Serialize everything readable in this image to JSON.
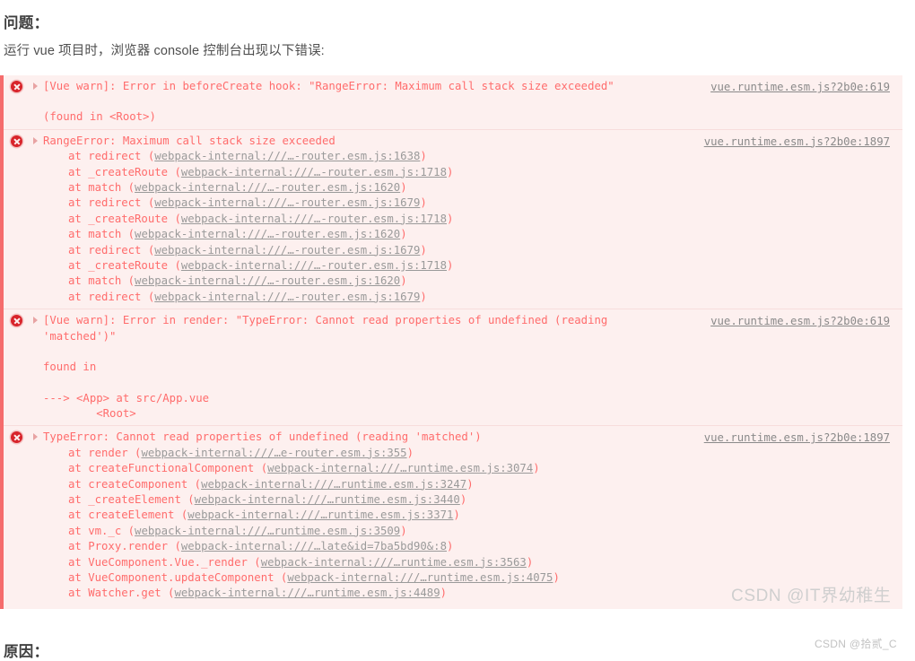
{
  "headings": {
    "problem": "问题：",
    "cause": "原因："
  },
  "intro": "运行 vue 项目时，浏览器 console 控制台出现以下错误:",
  "colors": {
    "console_background": "#fdf0ef",
    "console_border": "#f56c6c",
    "error_text": "#ff6c6c",
    "error_icon": "#d8232a",
    "link": "#8a8a8a",
    "heading": "#3f3f3f",
    "watermark": "#cfcfcf"
  },
  "console": {
    "rows": [
      {
        "id": "vue-warn-beforecreate",
        "icon": "error-circle-icon",
        "caret": "disclosure-triangle-icon",
        "message": "[Vue warn]: Error in beforeCreate hook: \"RangeError: Maximum call stack size exceeded\"",
        "source": "vue.runtime.esm.js?2b0e:619",
        "detail": "(found in <Root>)"
      },
      {
        "id": "rangeerror-stack",
        "icon": "error-circle-icon",
        "caret": "disclosure-triangle-icon",
        "message": "RangeError: Maximum call stack size exceeded",
        "source": "vue.runtime.esm.js?2b0e:1897",
        "stack": [
          {
            "fn": "at redirect",
            "loc": "webpack-internal:///…-router.esm.js:1638"
          },
          {
            "fn": "at _createRoute",
            "loc": "webpack-internal:///…-router.esm.js:1718"
          },
          {
            "fn": "at match",
            "loc": "webpack-internal:///…-router.esm.js:1620"
          },
          {
            "fn": "at redirect",
            "loc": "webpack-internal:///…-router.esm.js:1679"
          },
          {
            "fn": "at _createRoute",
            "loc": "webpack-internal:///…-router.esm.js:1718"
          },
          {
            "fn": "at match",
            "loc": "webpack-internal:///…-router.esm.js:1620"
          },
          {
            "fn": "at redirect",
            "loc": "webpack-internal:///…-router.esm.js:1679"
          },
          {
            "fn": "at _createRoute",
            "loc": "webpack-internal:///…-router.esm.js:1718"
          },
          {
            "fn": "at match",
            "loc": "webpack-internal:///…-router.esm.js:1620"
          },
          {
            "fn": "at redirect",
            "loc": "webpack-internal:///…-router.esm.js:1679"
          }
        ]
      },
      {
        "id": "vue-warn-render",
        "icon": "error-circle-icon",
        "caret": "disclosure-triangle-icon",
        "message": "[Vue warn]: Error in render: \"TypeError: Cannot read properties of undefined (reading\n'matched')\"",
        "source": "vue.runtime.esm.js?2b0e:619",
        "found_in_label": "found in",
        "component_tree": "---> <App> at src/App.vue\n        <Root>"
      },
      {
        "id": "typeerror-stack",
        "icon": "error-circle-icon",
        "caret": "disclosure-triangle-icon",
        "message": "TypeError: Cannot read properties of undefined (reading 'matched')",
        "source": "vue.runtime.esm.js?2b0e:1897",
        "stack": [
          {
            "fn": "at render",
            "loc": "webpack-internal:///…e-router.esm.js:355"
          },
          {
            "fn": "at createFunctionalComponent",
            "loc": "webpack-internal:///…runtime.esm.js:3074"
          },
          {
            "fn": "at createComponent",
            "loc": "webpack-internal:///…runtime.esm.js:3247"
          },
          {
            "fn": "at _createElement",
            "loc": "webpack-internal:///…runtime.esm.js:3440"
          },
          {
            "fn": "at createElement",
            "loc": "webpack-internal:///…runtime.esm.js:3371"
          },
          {
            "fn": "at vm._c",
            "loc": "webpack-internal:///…runtime.esm.js:3509"
          },
          {
            "fn": "at Proxy.render",
            "loc": "webpack-internal:///…late&id=7ba5bd90&:8"
          },
          {
            "fn": "at VueComponent.Vue._render",
            "loc": "webpack-internal:///…runtime.esm.js:3563"
          },
          {
            "fn": "at VueComponent.updateComponent",
            "loc": "webpack-internal:///…runtime.esm.js:4075"
          },
          {
            "fn": "at Watcher.get",
            "loc": "webpack-internal:///…runtime.esm.js:4489"
          }
        ]
      }
    ]
  },
  "watermarks": {
    "large": "CSDN @IT界幼稚生",
    "small": "CSDN @拾贰_C"
  }
}
